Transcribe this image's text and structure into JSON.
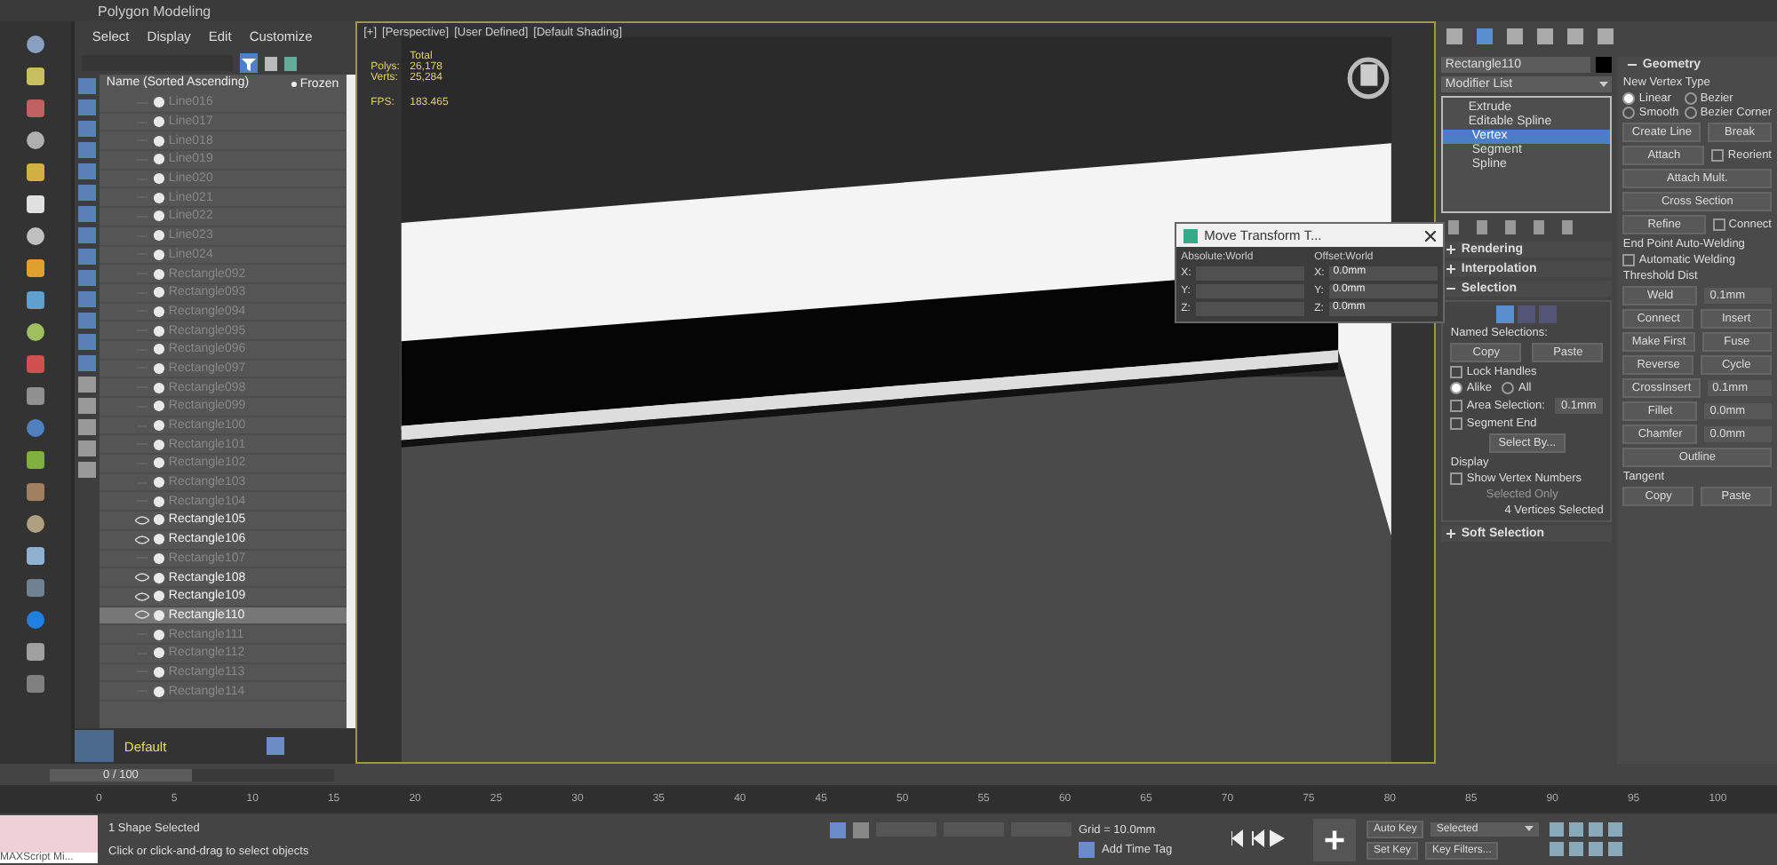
{
  "title_bar": {
    "title": "Polygon Modeling"
  },
  "scene_explorer": {
    "menu": [
      "Select",
      "Display",
      "Edit",
      "Customize"
    ],
    "header": {
      "name": "Name (Sorted Ascending)",
      "frozen": "Frozen"
    },
    "rows": [
      {
        "name": "Line016",
        "visible": false,
        "selected": false
      },
      {
        "name": "Line017",
        "visible": false,
        "selected": false
      },
      {
        "name": "Line018",
        "visible": false,
        "selected": false
      },
      {
        "name": "Line019",
        "visible": false,
        "selected": false
      },
      {
        "name": "Line020",
        "visible": false,
        "selected": false
      },
      {
        "name": "Line021",
        "visible": false,
        "selected": false
      },
      {
        "name": "Line022",
        "visible": false,
        "selected": false
      },
      {
        "name": "Line023",
        "visible": false,
        "selected": false
      },
      {
        "name": "Line024",
        "visible": false,
        "selected": false
      },
      {
        "name": "Rectangle092",
        "visible": false,
        "selected": false
      },
      {
        "name": "Rectangle093",
        "visible": false,
        "selected": false
      },
      {
        "name": "Rectangle094",
        "visible": false,
        "selected": false
      },
      {
        "name": "Rectangle095",
        "visible": false,
        "selected": false
      },
      {
        "name": "Rectangle096",
        "visible": false,
        "selected": false
      },
      {
        "name": "Rectangle097",
        "visible": false,
        "selected": false
      },
      {
        "name": "Rectangle098",
        "visible": false,
        "selected": false
      },
      {
        "name": "Rectangle099",
        "visible": false,
        "selected": false
      },
      {
        "name": "Rectangle100",
        "visible": false,
        "selected": false
      },
      {
        "name": "Rectangle101",
        "visible": false,
        "selected": false
      },
      {
        "name": "Rectangle102",
        "visible": false,
        "selected": false
      },
      {
        "name": "Rectangle103",
        "visible": false,
        "selected": false
      },
      {
        "name": "Rectangle104",
        "visible": false,
        "selected": false
      },
      {
        "name": "Rectangle105",
        "visible": true,
        "selected": false
      },
      {
        "name": "Rectangle106",
        "visible": true,
        "selected": false
      },
      {
        "name": "Rectangle107",
        "visible": false,
        "selected": false
      },
      {
        "name": "Rectangle108",
        "visible": true,
        "selected": false
      },
      {
        "name": "Rectangle109",
        "visible": true,
        "selected": false
      },
      {
        "name": "Rectangle110",
        "visible": true,
        "selected": true
      },
      {
        "name": "Rectangle111",
        "visible": false,
        "selected": false
      },
      {
        "name": "Rectangle112",
        "visible": false,
        "selected": false
      },
      {
        "name": "Rectangle113",
        "visible": false,
        "selected": false
      },
      {
        "name": "Rectangle114",
        "visible": false,
        "selected": false
      }
    ]
  },
  "viewport": {
    "labels": [
      "[+]",
      "[Perspective]",
      "[User Defined]",
      "[Default Shading]"
    ],
    "stats_header": "Total",
    "stats": [
      {
        "label": "Polys:",
        "value": "26,178"
      },
      {
        "label": "Verts:",
        "value": "25,284"
      },
      {
        "label": "FPS:",
        "value": "183.465"
      }
    ]
  },
  "move_dialog": {
    "title": "Move Transform T...",
    "absolute": "Absolute:World",
    "offset": "Offset:World",
    "axes": [
      "X:",
      "Y:",
      "Z:"
    ],
    "offset_axes": [
      "X:",
      "Y:",
      "Z:"
    ],
    "offset_values": [
      "0.0mm",
      "0.0mm",
      "0.0mm"
    ]
  },
  "command_panel": {
    "object_name": "Rectangle110",
    "modifier_list": "Modifier List",
    "stack": [
      {
        "name": "Extrude",
        "selected": false
      },
      {
        "name": "Editable Spline",
        "selected": false,
        "children": [
          {
            "name": "Vertex",
            "selected": true
          },
          {
            "name": "Segment",
            "selected": false
          },
          {
            "name": "Spline",
            "selected": false
          }
        ]
      }
    ],
    "rollouts": [
      {
        "title": "Rendering",
        "expanded": false
      },
      {
        "title": "Interpolation",
        "expanded": false
      },
      {
        "title": "Selection",
        "expanded": true
      },
      {
        "title": "Soft Selection",
        "expanded": false
      }
    ],
    "selection": {
      "named_label": "Named Selections:",
      "buttons": [
        "Copy",
        "Paste"
      ],
      "lock_handles": {
        "label": "Lock Handles",
        "checked": false
      },
      "radios": [
        {
          "label": "Alike",
          "selected": true
        },
        {
          "label": "All",
          "selected": false
        }
      ],
      "area": {
        "label": "Area Selection:",
        "checked": false,
        "value": "0.1mm"
      },
      "segment_end": {
        "label": "Segment End",
        "checked": false
      },
      "select_by": "Select By...",
      "display_label": "Display",
      "show_numbers": {
        "label": "Show Vertex Numbers",
        "checked": false
      },
      "selected_only": "Selected Only",
      "count": "4 Vertices Selected"
    },
    "geometry": {
      "title": "Geometry",
      "vertex_type_label": "New Vertex Type",
      "types": [
        {
          "label": "Linear",
          "selected": true
        },
        {
          "label": "Bezier",
          "selected": false
        },
        {
          "label": "Smooth",
          "selected": false
        },
        {
          "label": "Bezier Corner",
          "selected": false
        }
      ],
      "rows": [
        [
          {
            "kind": "button",
            "label": "Create Line"
          },
          {
            "kind": "button",
            "label": "Break"
          }
        ],
        [
          {
            "kind": "button",
            "label": "Attach"
          },
          {
            "kind": "check",
            "label": "Reorient",
            "checked": false
          }
        ],
        [
          {
            "kind": "button",
            "label": "Attach Mult."
          }
        ],
        [
          {
            "kind": "button",
            "label": "Cross Section"
          }
        ],
        [
          {
            "kind": "button",
            "label": "Refine"
          },
          {
            "kind": "check",
            "label": "Connect",
            "checked": false
          }
        ],
        [
          {
            "kind": "label",
            "label": "End Point Auto-Welding"
          }
        ],
        [
          {
            "kind": "check",
            "label": "Automatic Welding",
            "checked": false
          }
        ],
        [
          {
            "kind": "label",
            "label": "Threshold Dist"
          }
        ],
        [
          {
            "kind": "button",
            "label": "Weld"
          },
          {
            "kind": "spinner",
            "label": "0.1mm"
          }
        ],
        [
          {
            "kind": "button",
            "label": "Connect"
          },
          {
            "kind": "button",
            "label": "Insert"
          }
        ],
        [
          {
            "kind": "button",
            "label": "Make First"
          },
          {
            "kind": "button",
            "label": "Fuse"
          }
        ],
        [
          {
            "kind": "button",
            "label": "Reverse"
          },
          {
            "kind": "button",
            "label": "Cycle"
          }
        ],
        [
          {
            "kind": "button",
            "label": "CrossInsert"
          },
          {
            "kind": "spinner",
            "label": "0.1mm"
          }
        ],
        [
          {
            "kind": "button",
            "label": "Fillet"
          },
          {
            "kind": "spinner",
            "label": "0.0mm"
          }
        ],
        [
          {
            "kind": "button",
            "label": "Chamfer"
          },
          {
            "kind": "spinner",
            "label": "0.0mm"
          }
        ],
        [
          {
            "kind": "button",
            "label": "Outline"
          }
        ],
        [
          {
            "kind": "label",
            "label": "Tangent"
          }
        ],
        [
          {
            "kind": "button",
            "label": "Copy"
          },
          {
            "kind": "button",
            "label": "Paste"
          }
        ]
      ]
    }
  },
  "layer": {
    "name": "Default"
  },
  "time_slider": {
    "label": "0 / 100",
    "level": 0
  },
  "timeline": {
    "ticks": [
      "0",
      "5",
      "10",
      "15",
      "20",
      "25",
      "30",
      "35",
      "40",
      "45",
      "50",
      "55",
      "60",
      "65",
      "70",
      "75",
      "80",
      "85",
      "90",
      "95",
      "100"
    ]
  },
  "status": {
    "maxscript": "MAXScript Mi...",
    "selection": "1 Shape Selected",
    "prompt": "Click or click-and-drag to select objects",
    "grid": "Grid = 10.0mm",
    "time_tag": "Add Time Tag",
    "auto_key": "Auto Key",
    "set_key": "Set Key",
    "key_mode": "Selected",
    "key_filters": "Key Filters..."
  }
}
